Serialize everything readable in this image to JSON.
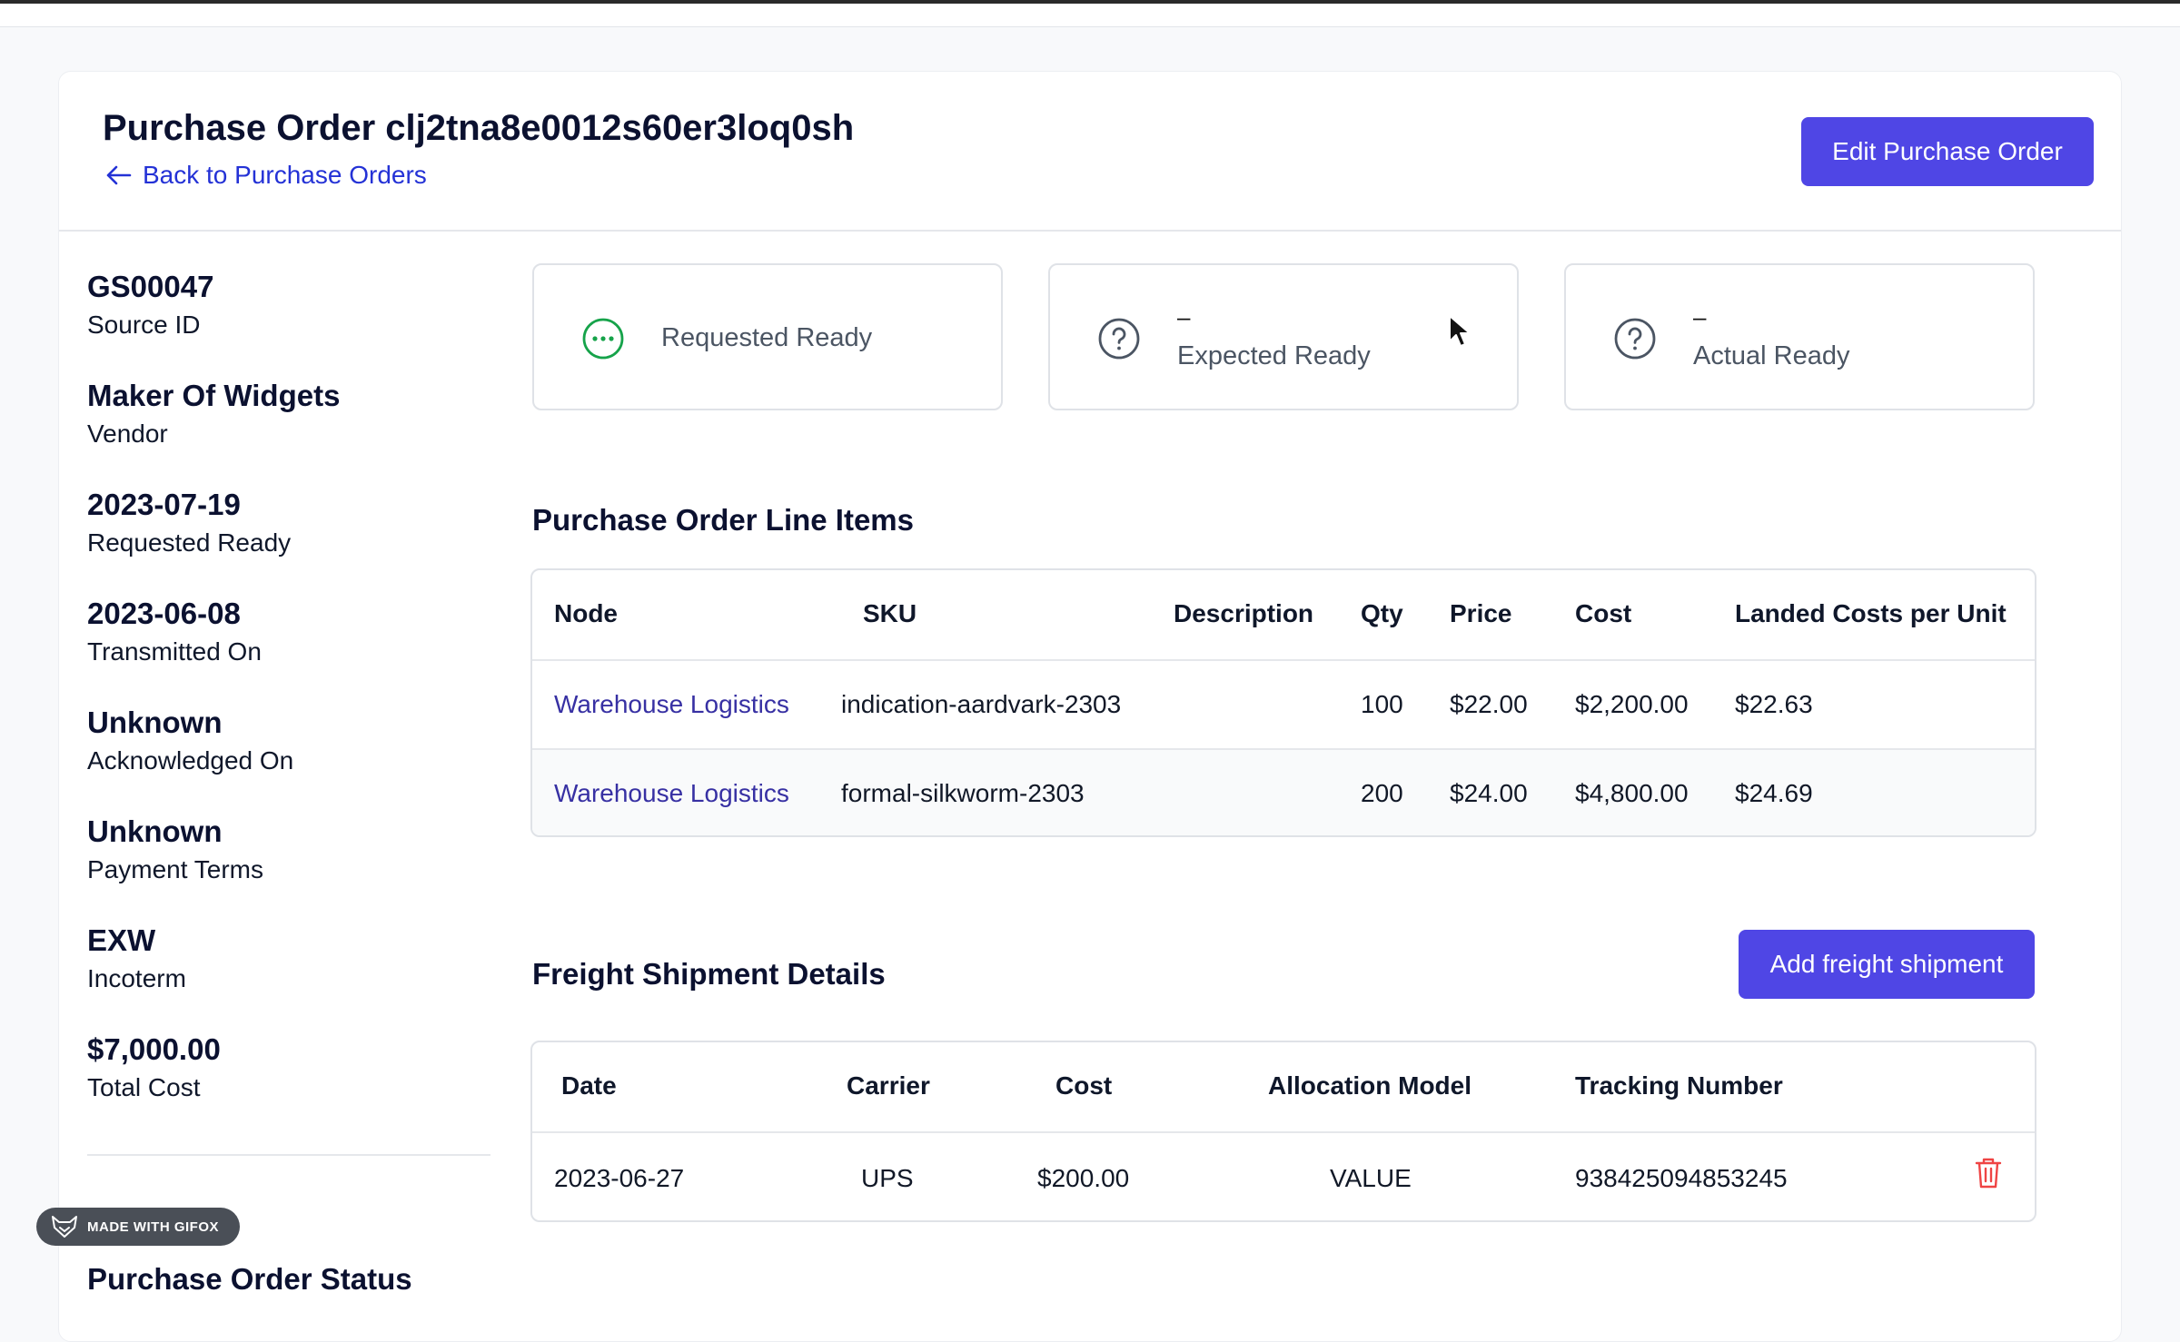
{
  "header": {
    "title": "Purchase Order clj2tna8e0012s60er3loq0sh",
    "back_label": "Back to Purchase Orders",
    "edit_label": "Edit Purchase Order"
  },
  "details": [
    {
      "value": "GS00047",
      "label": "Source ID"
    },
    {
      "value": "Maker Of Widgets",
      "label": "Vendor"
    },
    {
      "value": "2023-07-19",
      "label": "Requested Ready"
    },
    {
      "value": "2023-06-08",
      "label": "Transmitted On"
    },
    {
      "value": "Unknown",
      "label": "Acknowledged On"
    },
    {
      "value": "Unknown",
      "label": "Payment Terms"
    },
    {
      "value": "EXW",
      "label": "Incoterm"
    },
    {
      "value": "$7,000.00",
      "label": "Total Cost"
    }
  ],
  "status_heading": "Purchase Order Status",
  "status_cards": [
    {
      "label": "Requested Ready",
      "icon": "ellipsis-circle-icon",
      "color": "#16a34a"
    },
    {
      "value": "–",
      "label": "Expected Ready",
      "icon": "question-circle-icon"
    },
    {
      "value": "–",
      "label": "Actual Ready",
      "icon": "question-circle-icon"
    }
  ],
  "line_items": {
    "title": "Purchase Order Line Items",
    "headers": [
      "Node",
      "SKU",
      "Description",
      "Qty",
      "Price",
      "Cost",
      "Landed Costs per Unit"
    ],
    "rows": [
      {
        "node": "Warehouse Logistics",
        "sku": "indication-aardvark-2303",
        "description": "",
        "qty": "100",
        "price": "$22.00",
        "cost": "$2,200.00",
        "landed": "$22.63"
      },
      {
        "node": "Warehouse Logistics",
        "sku": "formal-silkworm-2303",
        "description": "",
        "qty": "200",
        "price": "$24.00",
        "cost": "$4,800.00",
        "landed": "$24.69"
      }
    ]
  },
  "freight": {
    "title": "Freight Shipment Details",
    "add_label": "Add freight shipment",
    "headers": [
      "Date",
      "Carrier",
      "Cost",
      "Allocation Model",
      "Tracking Number"
    ],
    "rows": [
      {
        "date": "2023-06-27",
        "carrier": "UPS",
        "cost": "$200.00",
        "allocation": "VALUE",
        "tracking": "938425094853245",
        "action_icon": "trash-icon"
      }
    ]
  },
  "watermark": "MADE WITH GIFOX",
  "colors": {
    "primary": "#4f46e5",
    "link": "#3730a3",
    "success": "#16a34a",
    "danger": "#ef4444"
  }
}
